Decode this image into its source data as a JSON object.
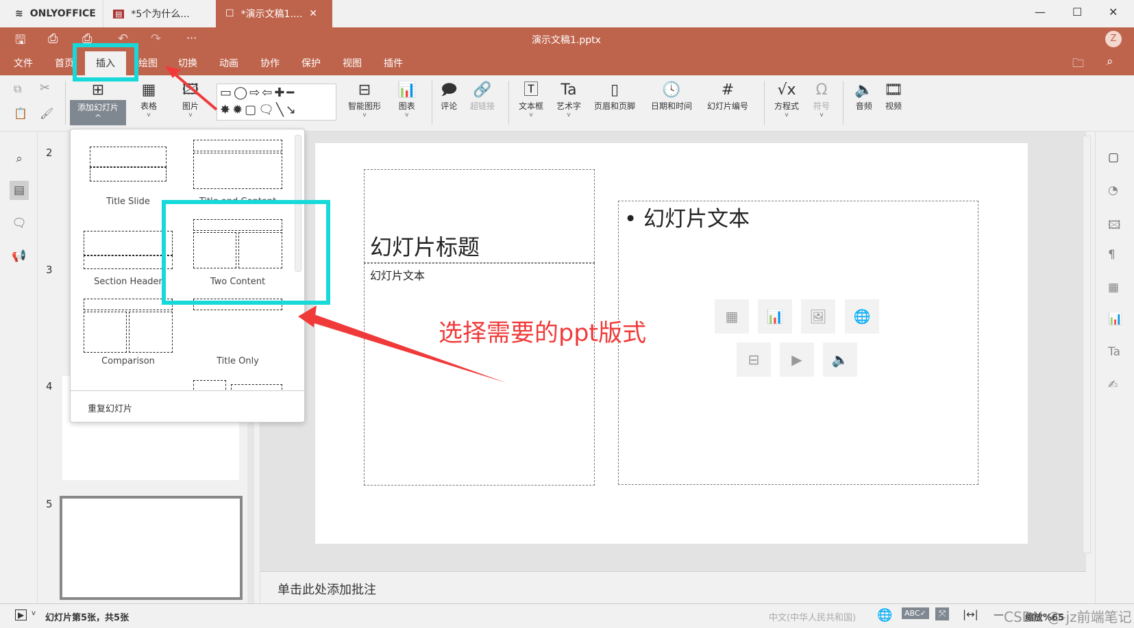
{
  "app": {
    "brand": "ONLYOFFICE",
    "tabs": [
      {
        "label": "*5个为什么..."
      },
      {
        "label": "*演示文稿1...."
      }
    ],
    "file_title": "演示文稿1.pptx",
    "user_initial": "Z"
  },
  "colors": {
    "header": "#bf644c",
    "highlight": "#17d9d9",
    "annotation": "#f03a3a"
  },
  "menu": [
    "文件",
    "首页",
    "插入",
    "绘图",
    "切换",
    "动画",
    "协作",
    "保护",
    "视图",
    "插件"
  ],
  "toolbar": {
    "add_slide": "添加幻灯片",
    "table": "表格",
    "image": "图片",
    "smartart": "智能图形",
    "chart": "图表",
    "comment": "评论",
    "hyperlink": "超链接",
    "textbox": "文本框",
    "textart": "艺术字",
    "header_footer": "页眉和页脚",
    "datetime": "日期和时间",
    "slide_number": "幻灯片编号",
    "equation": "方程式",
    "symbol": "符号",
    "audio": "音频",
    "video": "视频"
  },
  "layouts": {
    "items": [
      "Title Slide",
      "Title and Content",
      "Section Header",
      "Two Content",
      "Comparison",
      "Title Only"
    ],
    "duplicate": "重复幻灯片"
  },
  "thumbnails": [
    "2",
    "3",
    "4",
    "5"
  ],
  "slide": {
    "title": "幻灯片标题",
    "subtitle": "幻灯片文本",
    "bullet": "幻灯片文本"
  },
  "annotation": "选择需要的ppt版式",
  "notes_placeholder": "单击此处添加批注",
  "status": {
    "slide_info": "幻灯片第5张，共5张",
    "language": "中文(中华人民共和国)",
    "zoom": "缩放%65",
    "watermark": "CSDN @-jz前端笔记"
  }
}
